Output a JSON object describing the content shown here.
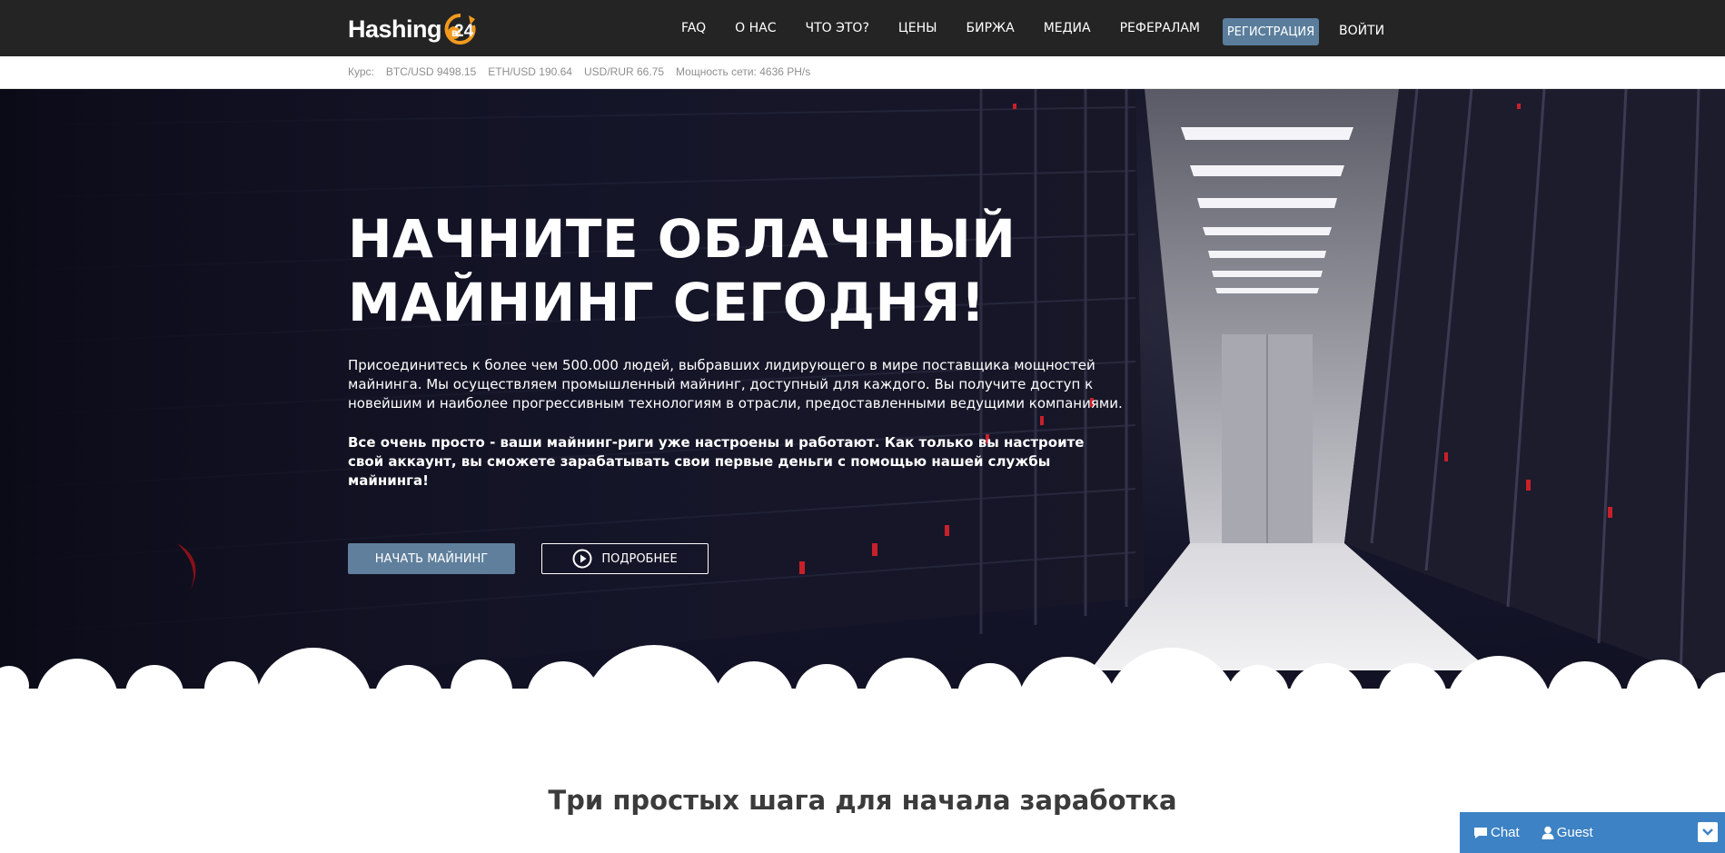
{
  "header": {
    "logo_text": "Hashing",
    "logo_number": "24",
    "nav": [
      "FAQ",
      "О НАС",
      "ЧТО ЭТО?",
      "ЦЕНЫ",
      "БИРЖА",
      "МЕДИА",
      "РЕФЕРАЛАМ"
    ],
    "register_label": "РЕГИСТРАЦИЯ",
    "login_label": "ВОЙТИ"
  },
  "rates": {
    "label": "Курс:",
    "btc_usd": "BTC/USD 9498.15",
    "eth_usd": "ETH/USD 190.64",
    "usd_rur": "USD/RUR 66.75",
    "hashrate": "Мощность сети: 4636 PH/s"
  },
  "hero": {
    "title_line1": "НАЧНИТЕ ОБЛАЧНЫЙ",
    "title_line2": "МАЙНИНГ СЕГОДНЯ!",
    "text": "Присоединитесь к более чем 500.000 людей, выбравших лидирующего в мире поставщика мощностей майнинга. Мы осуществляем промышленный майнинг, доступный для каждого. Вы получите доступ к новейшим и наиболее прогрессивным технологиям в отрасли, предоставленными ведущими компаниями.",
    "bold_text": "Все очень просто - ваши майнинг-риги уже настроены и работают. Как только вы настроите свой аккаунт, вы сможете зарабатывать свои первые деньги с помощью нашей службы майнинга!",
    "start_label": "НАЧАТЬ МАЙНИНГ",
    "more_label": "ПОДРОБНЕЕ"
  },
  "section": {
    "title": "Три простых шага для начала заработка"
  },
  "chat": {
    "chat_label": "Chat",
    "guest_label": "Guest"
  },
  "colors": {
    "header_bg": "#242424",
    "accent": "#5a7d9c",
    "logo_orange": "#f29a1f",
    "chat_bg": "#3d82c4"
  }
}
